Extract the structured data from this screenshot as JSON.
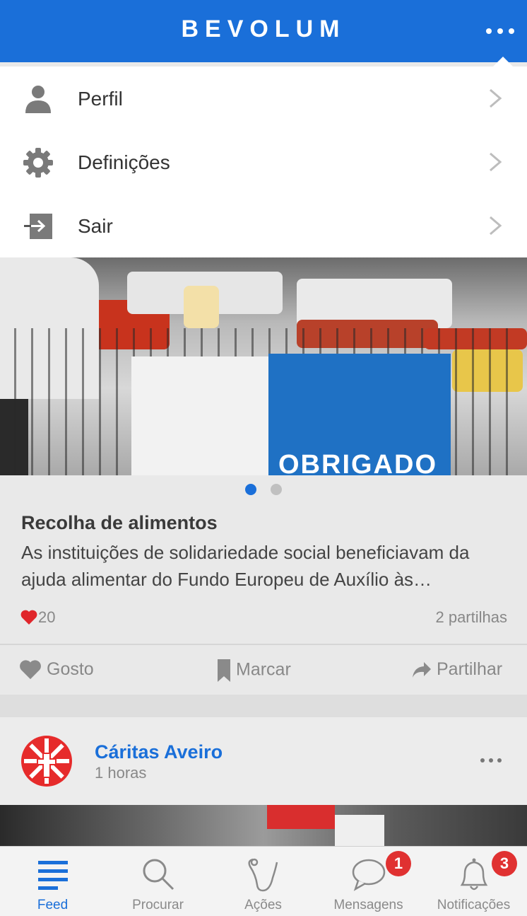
{
  "app": {
    "title": "BEVOLUM",
    "brand_color": "#1a6fd9",
    "menu_icon": "more-horizontal-icon"
  },
  "menu": {
    "items": [
      {
        "label": "Perfil",
        "icon": "user-icon"
      },
      {
        "label": "Definições",
        "icon": "gear-icon"
      },
      {
        "label": "Sair",
        "icon": "logout-icon"
      }
    ]
  },
  "carousel": {
    "pages": 2,
    "active_index": 0,
    "active_color": "#1a6fd9",
    "inactive_color": "#c0c0c0",
    "image_text": "OBRIGADO"
  },
  "post": {
    "title": "Recolha de alimentos",
    "text": "As instituições de solidariedade social beneficiavam da ajuda alimentar do Fundo Europeu de Auxílio às…",
    "likes": "20",
    "shares": "2 partilhas",
    "actions": {
      "like": "Gosto",
      "bookmark": "Marcar",
      "share": "Partilhar"
    }
  },
  "next_post": {
    "author": "Cáritas Aveiro",
    "time": "1 horas"
  },
  "tabbar": {
    "active_color": "#1a6fd9",
    "tabs": [
      {
        "label": "Feed",
        "icon": "feed-icon",
        "active": true
      },
      {
        "label": "Procurar",
        "icon": "search-icon"
      },
      {
        "label": "Ações",
        "icon": "actions-icon"
      },
      {
        "label": "Mensagens",
        "icon": "chat-icon",
        "badge": "1"
      },
      {
        "label": "Notificações",
        "icon": "bell-icon",
        "badge": "3"
      }
    ]
  }
}
